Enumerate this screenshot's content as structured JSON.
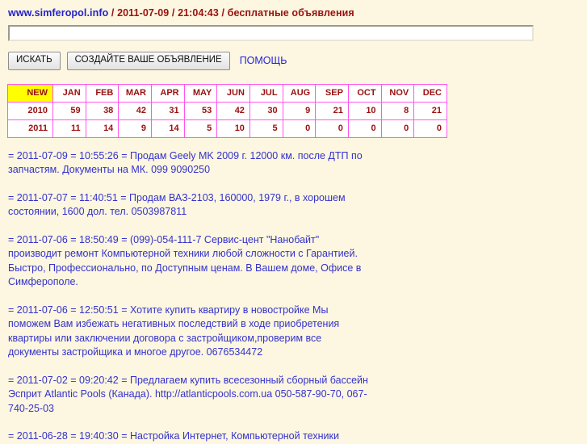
{
  "header": {
    "brand": "www.simferopol.info",
    "sep": "/",
    "date": "2011-07-09",
    "time": "21:04:43",
    "tagline": "бесплатные объявления"
  },
  "search": {
    "value": "",
    "placeholder": ""
  },
  "toolbar": {
    "search_button": "ИСКАТЬ",
    "create_button": "СОЗДАЙТЕ ВАШЕ ОБЪЯВЛЕНИЕ",
    "help_link": "ПОМОЩЬ"
  },
  "stats_table": {
    "new_label": "NEW",
    "months": [
      "JAN",
      "FEB",
      "MAR",
      "APR",
      "MAY",
      "JUN",
      "JUL",
      "AUG",
      "SEP",
      "OCT",
      "NOV",
      "DEC"
    ],
    "rows": [
      {
        "year": "2010",
        "values": [
          "59",
          "38",
          "42",
          "31",
          "53",
          "42",
          "30",
          "9",
          "21",
          "10",
          "8",
          "21"
        ]
      },
      {
        "year": "2011",
        "values": [
          "11",
          "14",
          "9",
          "14",
          "5",
          "10",
          "5",
          "0",
          "0",
          "0",
          "0",
          "0"
        ]
      }
    ]
  },
  "colors": {
    "page_background": "#fdf6e0",
    "brand_blue": "#2222cc",
    "header_red": "#99110f",
    "table_border_magenta": "#ff55ee",
    "new_cell_yellow": "#ffff00",
    "listing_blue": "#3333cc"
  },
  "listings": [
    {
      "date": "2011-07-09",
      "time": "10:55:26",
      "text": "Продам Geely MK 2009 г. 12000 км. после ДТП по запчастям. Документы на МК. 099 9090250"
    },
    {
      "date": "2011-07-07",
      "time": "11:40:51",
      "text": "Продам ВАЗ-2103, 160000, 1979 г., в хорошем состоянии, 1600 дол. тел. 0503987811"
    },
    {
      "date": "2011-07-06",
      "time": "18:50:49",
      "text": "(099)-054-111-7 Сервис-цент \"Нанобайт\" производит ремонт Компьютерной техники любой сложности с Гарантией. Быстро, Профессионально, по Доступным ценам. В Вашем доме, Офисе в Симферополе."
    },
    {
      "date": "2011-07-06",
      "time": "12:50:51",
      "text": "Хотите купить квартиру в новостройке Мы поможем Вам избежать негативных последствий в ходе приобретения квартиры или заключении договора с застройщиком,проверим все документы застройщика и многое другое. 0676534472"
    },
    {
      "date": "2011-07-02",
      "time": "09:20:42",
      "text": "Предлагаем купить всесезонный сборный бассейн Эсприт Atlantic Pools (Канада). http://atlanticpools.com.ua 050-587-90-70, 067-740-25-03"
    },
    {
      "date": "2011-06-28",
      "time": "19:40:30",
      "text": "Настройка Интернет, Компьютерной техники"
    }
  ]
}
